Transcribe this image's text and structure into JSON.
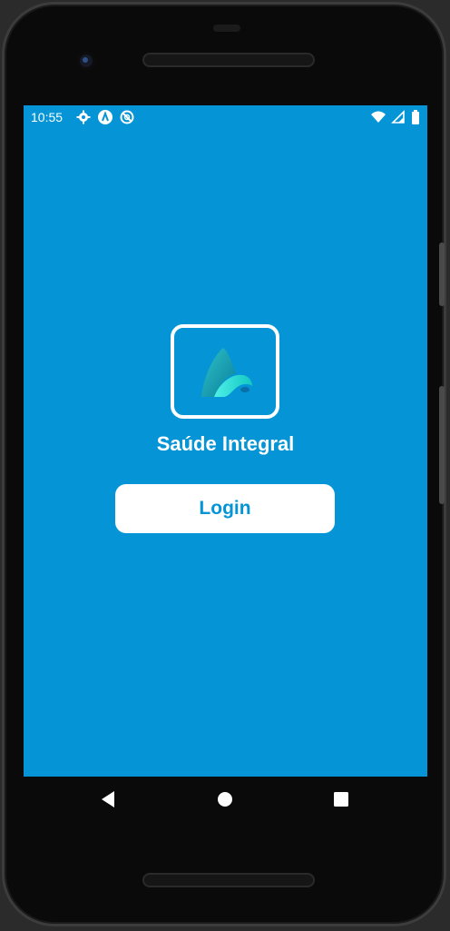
{
  "status_bar": {
    "time": "10:55",
    "left_icons": [
      "gear-icon",
      "a-badge-icon",
      "no-sync-icon"
    ],
    "right_icons": [
      "wifi-icon",
      "cell-signal-icon",
      "battery-icon"
    ]
  },
  "app": {
    "title": "Saúde Integral",
    "login_label": "Login",
    "background_color": "#0595d6",
    "accent_color": "#ffffff"
  },
  "nav_bar": {
    "buttons": [
      "back-icon",
      "home-icon",
      "recents-icon"
    ]
  }
}
